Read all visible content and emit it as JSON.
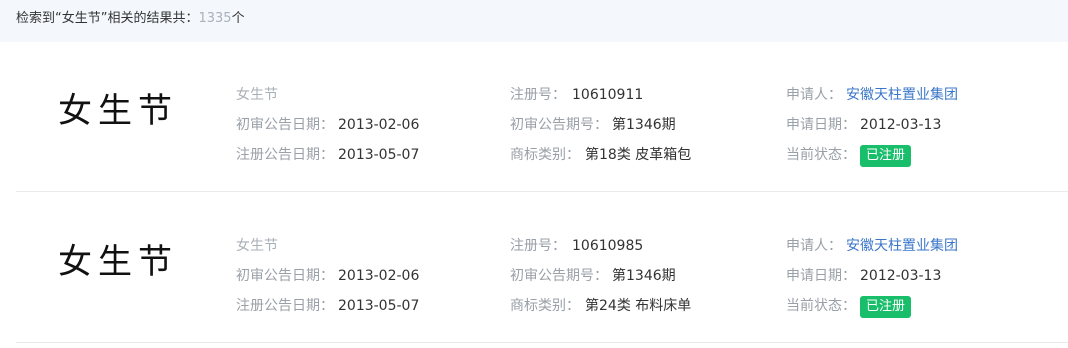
{
  "search_summary": {
    "prefix": "检索到“女生节”相关的结果共：",
    "count": "1335",
    "suffix": "个"
  },
  "labels": {
    "reg_no": "注册号：",
    "prelim_date": "初审公告日期：",
    "prelim_issue": "初审公告期号：",
    "reg_date": "注册公告日期：",
    "category": "商标类别：",
    "applicant": "申请人：",
    "apply_date": "申请日期：",
    "status": "当前状态："
  },
  "results": [
    {
      "logo_text": "女生节",
      "name": "女生节",
      "reg_no": "10610911",
      "prelim_date": "2013-02-06",
      "prelim_issue": "第1346期",
      "reg_date": "2013-05-07",
      "category": "第18类 皮革箱包",
      "applicant": "安徽天柱置业集团",
      "apply_date": "2012-03-13",
      "status": "已注册"
    },
    {
      "logo_text": "女生节",
      "name": "女生节",
      "reg_no": "10610985",
      "prelim_date": "2013-02-06",
      "prelim_issue": "第1346期",
      "reg_date": "2013-05-07",
      "category": "第24类 布料床单",
      "applicant": "安徽天柱置业集团",
      "apply_date": "2012-03-13",
      "status": "已注册"
    }
  ],
  "colors": {
    "status_badge": "#19be6b",
    "link": "#3b77c9",
    "summary_bg": "#f4f8fd"
  }
}
